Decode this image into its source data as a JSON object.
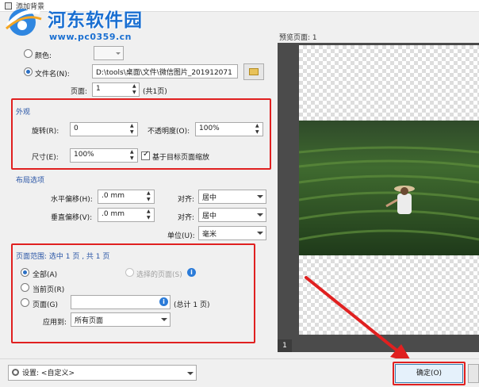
{
  "window": {
    "title": "添加背景"
  },
  "watermark": {
    "title": "河东软件园",
    "url": "www.pc0359.cn"
  },
  "source": {
    "color_label": "颜色:",
    "file_label": "文件名(N):",
    "file_value": "D:\\tools\\桌面\\文件\\微信图片_201912071",
    "page_label": "页面:",
    "page_value": "1",
    "page_total": "(共1页)"
  },
  "appearance": {
    "heading": "外观",
    "rotation_label": "旋转(R):",
    "rotation_value": "0",
    "opacity_label": "不透明度(O):",
    "opacity_value": "100%",
    "size_label": "尺寸(E):",
    "size_value": "100%",
    "scale_label": "基于目标页面缩放",
    "scale_checked": true
  },
  "layout": {
    "heading": "布局选项",
    "h_offset_label": "水平偏移(H):",
    "h_offset_value": ".0 mm",
    "v_offset_label": "垂直偏移(V):",
    "v_offset_value": ".0 mm",
    "h_align_label": "对齐:",
    "h_align_value": "居中",
    "v_align_label": "对齐:",
    "v_align_value": "居中",
    "unit_label": "单位(U):",
    "unit_value": "毫米"
  },
  "page_range": {
    "heading": "页面范围: 选中 1 页 , 共 1 页",
    "all_label": "全部(A)",
    "selected_label": "选择的页面(S)",
    "current_label": "当前页(R)",
    "pages_label": "页面(G)",
    "pages_value": "",
    "pages_total": "(总计 1 页)",
    "apply_label": "应用到:",
    "apply_value": "所有页面"
  },
  "preview": {
    "label": "预览页面: 1",
    "page_number": "1"
  },
  "footer": {
    "settings_label": "设置:",
    "settings_value": "<自定义>",
    "ok_label": "确定(O)"
  },
  "colors": {
    "accent": "#2b6fc4",
    "highlight": "#e02020"
  }
}
